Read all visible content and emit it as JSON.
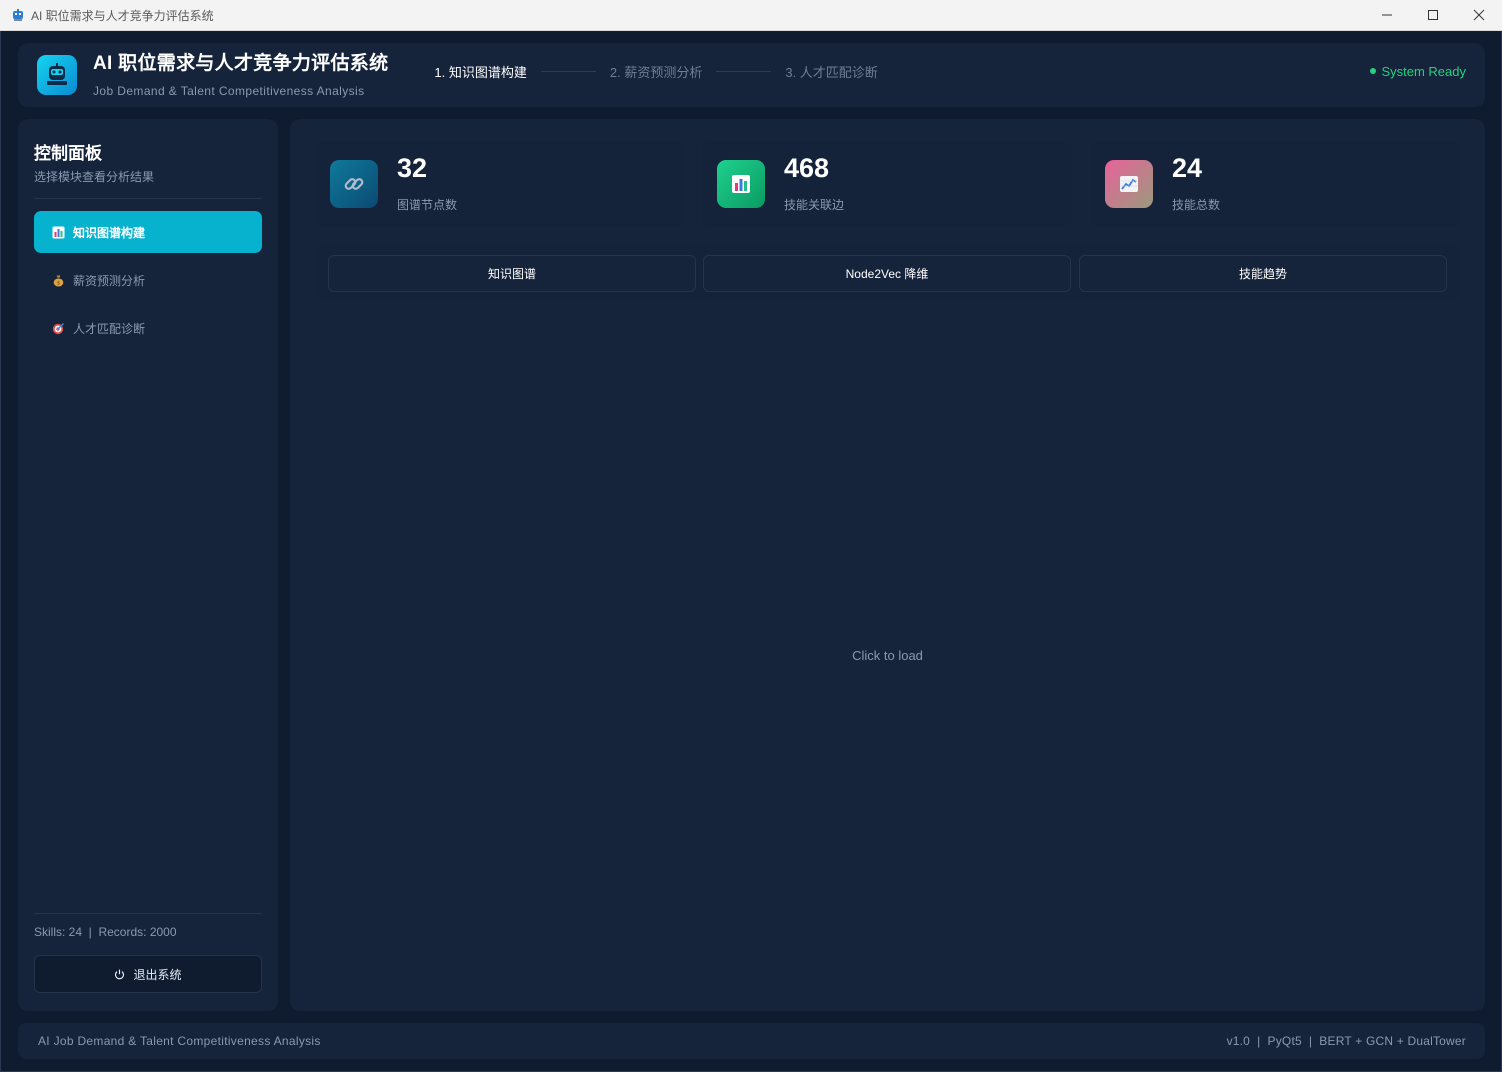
{
  "window": {
    "title": "AI 职位需求与人才竞争力评估系统"
  },
  "header": {
    "title": "AI 职位需求与人才竞争力评估系统",
    "subtitle": "Job Demand & Talent Competitiveness Analysis",
    "steps": [
      {
        "label": "1. 知识图谱构建",
        "active": true
      },
      {
        "label": "2. 薪资预测分析",
        "active": false
      },
      {
        "label": "3. 人才匹配诊断",
        "active": false
      }
    ],
    "status": "System Ready",
    "status_color": "#22d37f"
  },
  "sidebar": {
    "title": "控制面板",
    "subtitle": "选择模块查看分析结果",
    "items": [
      {
        "label": "知识图谱构建",
        "icon": "bar-chart-icon",
        "active": true
      },
      {
        "label": "薪资预测分析",
        "icon": "money-bag-icon",
        "active": false
      },
      {
        "label": "人才匹配诊断",
        "icon": "target-icon",
        "active": false
      }
    ],
    "stats": "Skills: 24  |  Records: 2000",
    "logout_label": "退出系统"
  },
  "main": {
    "cards": [
      {
        "value": "32",
        "label": "图谱节点数",
        "icon": "link-icon"
      },
      {
        "value": "468",
        "label": "技能关联边",
        "icon": "bar-chart-icon"
      },
      {
        "value": "24",
        "label": "技能总数",
        "icon": "trend-chart-icon"
      }
    ],
    "tabs": [
      {
        "label": "知识图谱"
      },
      {
        "label": "Node2Vec 降维"
      },
      {
        "label": "技能趋势"
      }
    ],
    "placeholder": "Click to load"
  },
  "footer": {
    "left": "AI Job Demand & Talent Competitiveness Analysis",
    "right": "v1.0  |  PyQt5  |  BERT + GCN + DualTower"
  },
  "colors": {
    "accent": "#07b2cf",
    "background": "#0f1b2f",
    "panel": "#15233b"
  }
}
